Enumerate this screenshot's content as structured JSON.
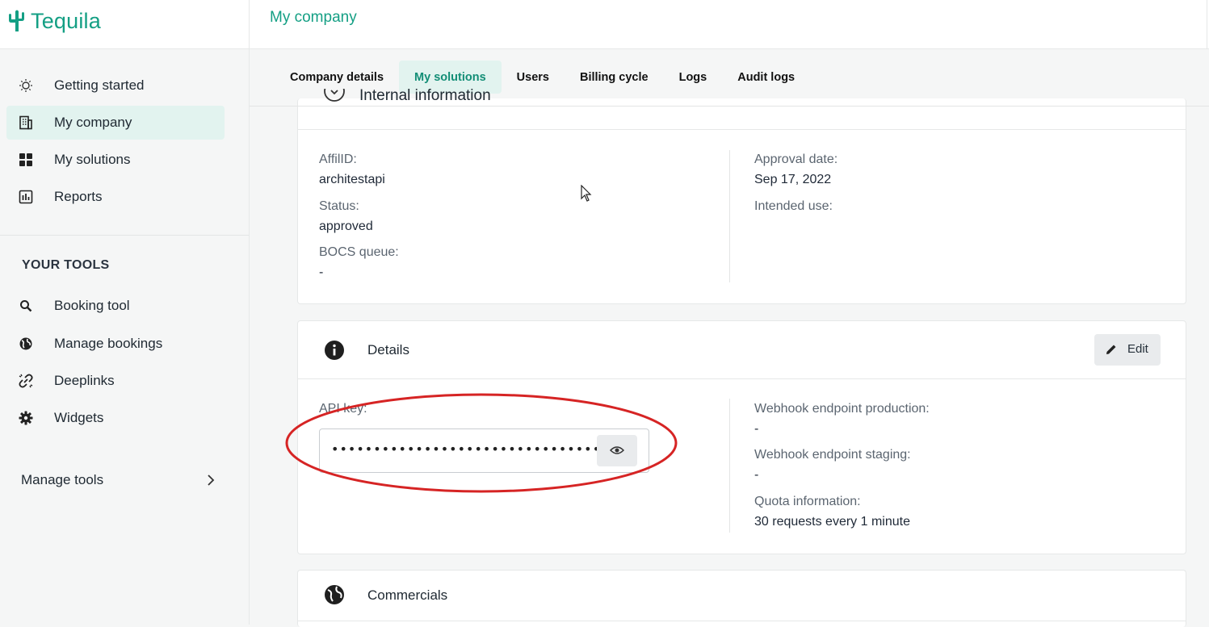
{
  "app": {
    "name": "Tequila",
    "page_title": "My company"
  },
  "colors": {
    "brand": "#149f84",
    "active_bg": "#e2f3ef",
    "annotation": "#d62424"
  },
  "sidebar": {
    "items": [
      {
        "label": "Getting started",
        "icon": "lightbulb-icon"
      },
      {
        "label": "My company",
        "icon": "building-icon",
        "active": true
      },
      {
        "label": "My solutions",
        "icon": "grid-icon"
      },
      {
        "label": "Reports",
        "icon": "report-chart-icon"
      }
    ],
    "tools_title": "YOUR TOOLS",
    "tools": [
      {
        "label": "Booking tool",
        "icon": "search-icon"
      },
      {
        "label": "Manage bookings",
        "icon": "globe-icon"
      },
      {
        "label": "Deeplinks",
        "icon": "link-icon"
      },
      {
        "label": "Widgets",
        "icon": "gear-icon"
      }
    ],
    "manage_tools": "Manage tools"
  },
  "tabs": [
    {
      "label": "Company details"
    },
    {
      "label": "My solutions",
      "active": true
    },
    {
      "label": "Users"
    },
    {
      "label": "Billing cycle"
    },
    {
      "label": "Logs"
    },
    {
      "label": "Audit logs"
    }
  ],
  "internal": {
    "title": "Internal information",
    "affilid_label": "AffilID:",
    "affilid_value": "architestapi",
    "status_label": "Status:",
    "status_value": "approved",
    "bocs_label": "BOCS queue:",
    "bocs_value": "-",
    "approval_label": "Approval date:",
    "approval_value": "Sep 17, 2022",
    "intended_label": "Intended use:"
  },
  "details": {
    "title": "Details",
    "edit_label": "Edit",
    "api_key_label": "API key:",
    "api_key_value": "••••••••••••••••••••••••••••••••",
    "webhook_prod_label": "Webhook endpoint production:",
    "webhook_prod_value": "-",
    "webhook_staging_label": "Webhook endpoint staging:",
    "webhook_staging_value": "-",
    "quota_label": "Quota information:",
    "quota_value": "30 requests every 1 minute"
  },
  "commercials": {
    "title": "Commercials"
  }
}
